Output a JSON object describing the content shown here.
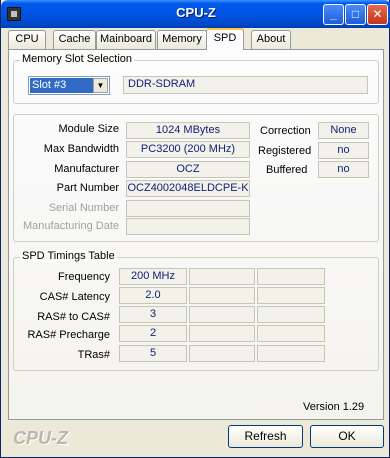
{
  "window": {
    "title": "CPU-Z"
  },
  "titlebar_buttons": {
    "minimize": "_",
    "maximize": "□",
    "close": "✕"
  },
  "tabs": [
    {
      "label": "CPU"
    },
    {
      "label": "Cache"
    },
    {
      "label": "Mainboard"
    },
    {
      "label": "Memory"
    },
    {
      "label": "SPD"
    },
    {
      "label": "About"
    }
  ],
  "slot_selection": {
    "legend": "Memory Slot Selection",
    "selected_slot": "Slot #3",
    "memory_type": "DDR-SDRAM"
  },
  "module": {
    "size_label": "Module Size",
    "size_value": "1024 MBytes",
    "bandwidth_label": "Max Bandwidth",
    "bandwidth_value": "PC3200 (200 MHz)",
    "manufacturer_label": "Manufacturer",
    "manufacturer_value": "OCZ",
    "part_label": "Part Number",
    "part_value": "OCZ4002048ELDCPE-K",
    "serial_label": "Serial Number",
    "serial_value": "",
    "date_label": "Manufacturing Date",
    "date_value": "",
    "correction_label": "Correction",
    "correction_value": "None",
    "registered_label": "Registered",
    "registered_value": "no",
    "buffered_label": "Buffered",
    "buffered_value": "no"
  },
  "timings": {
    "legend": "SPD Timings Table",
    "rows": [
      {
        "label": "Frequency",
        "value": "200 MHz"
      },
      {
        "label": "CAS# Latency",
        "value": "2.0"
      },
      {
        "label": "RAS# to CAS#",
        "value": "3"
      },
      {
        "label": "RAS# Precharge",
        "value": "2"
      },
      {
        "label": "TRas#",
        "value": "5"
      }
    ]
  },
  "version": "Version 1.29",
  "brand": "CPU-Z",
  "buttons": {
    "refresh": "Refresh",
    "ok": "OK"
  }
}
